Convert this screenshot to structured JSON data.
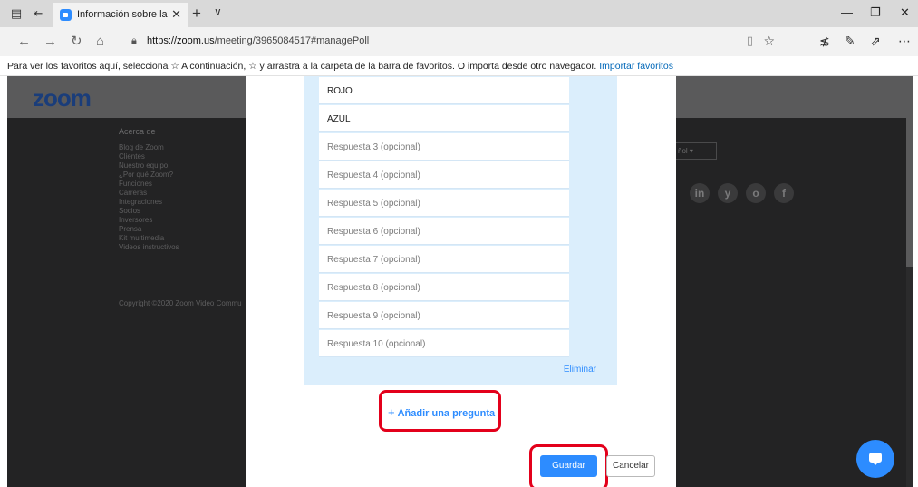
{
  "browser": {
    "tab_title": "Información sobre la reu",
    "tab_close": "✕",
    "new_tab": "+",
    "tab_menu": "∨",
    "url_host": "https://zoom.us",
    "url_path": "/meeting/3965084517#managePoll",
    "window_controls": {
      "minimize": "—",
      "restore": "❐",
      "close": "✕"
    }
  },
  "favorites_bar": {
    "message": "Para ver los favoritos aquí, selecciona ☆ A continuación, ☆ y arrastra a la carpeta de la barra de favoritos. O importa desde otro navegador.",
    "import_link": "Importar favoritos"
  },
  "page": {
    "logo": "zoom",
    "about_title": "Acerca de",
    "footer_links": [
      "Blog de Zoom",
      "Clientes",
      "Nuestro equipo",
      "¿Por qué Zoom?",
      "Funciones",
      "Carreras",
      "Integraciones",
      "Socios",
      "Inversores",
      "Prensa",
      "Kit multimedia",
      "Videos instructivos"
    ],
    "copyright": "Copyright ©2020 Zoom Video Commu",
    "language": "ñol ▾",
    "social": [
      "in",
      "y",
      "o",
      "f"
    ]
  },
  "poll": {
    "answers": [
      {
        "text": "ROJO",
        "filled": true
      },
      {
        "text": "AZUL",
        "filled": true
      },
      {
        "text": "Respuesta 3 (opcional)",
        "filled": false
      },
      {
        "text": "Respuesta 4 (opcional)",
        "filled": false
      },
      {
        "text": "Respuesta 5 (opcional)",
        "filled": false
      },
      {
        "text": "Respuesta 6 (opcional)",
        "filled": false
      },
      {
        "text": "Respuesta 7 (opcional)",
        "filled": false
      },
      {
        "text": "Respuesta 8 (opcional)",
        "filled": false
      },
      {
        "text": "Respuesta 9 (opcional)",
        "filled": false
      },
      {
        "text": "Respuesta 10 (opcional)",
        "filled": false
      }
    ],
    "delete_label": "Eliminar",
    "add_question_plus": "+",
    "add_question_label": "Añadir una pregunta",
    "save_label": "Guardar",
    "cancel_label": "Cancelar"
  },
  "colors": {
    "zoom_blue": "#2d8cff",
    "highlight_red": "#e3001b"
  }
}
